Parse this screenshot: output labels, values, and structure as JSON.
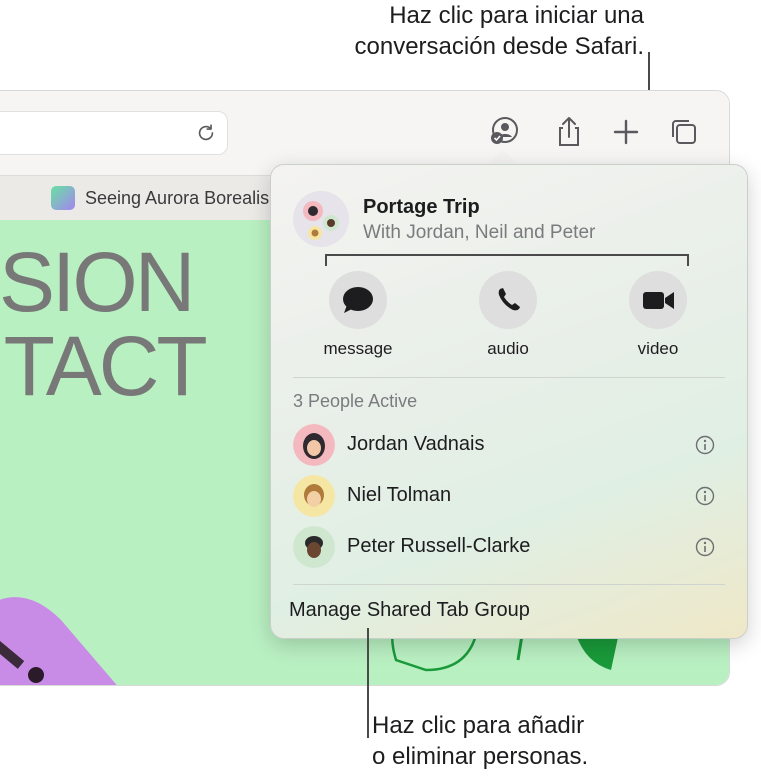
{
  "callouts": {
    "top_line1": "Haz clic para iniciar una",
    "top_line2": "conversación desde Safari.",
    "bottom_line1": "Haz clic para añadir",
    "bottom_line2": "o eliminar personas."
  },
  "browser": {
    "tab_title": "Seeing Aurora Borealis",
    "page_text_line1": "SSION",
    "page_text_line2": "NTACT"
  },
  "popover": {
    "group_name": "Portage Trip",
    "group_members": "With Jordan, Neil and Peter",
    "actions": [
      {
        "label": "message",
        "icon": "message-bubble-icon"
      },
      {
        "label": "audio",
        "icon": "phone-icon"
      },
      {
        "label": "video",
        "icon": "video-camera-icon"
      }
    ],
    "active_title": "3 People Active",
    "people": [
      {
        "name": "Jordan Vadnais",
        "avatar_color": "#f3b9bf"
      },
      {
        "name": "Niel Tolman",
        "avatar_color": "#f6e6a3"
      },
      {
        "name": "Peter Russell-Clarke",
        "avatar_color": "#cfe7cf"
      }
    ],
    "manage_label": "Manage Shared Tab Group"
  }
}
